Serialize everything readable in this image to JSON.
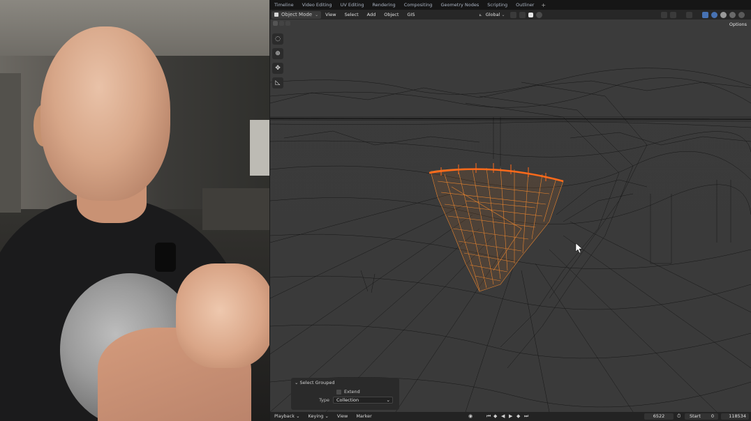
{
  "workspace_tabs": [
    "Timeline",
    "Video Editing",
    "UV Editing",
    "Rendering",
    "Compositing",
    "Geometry Nodes",
    "Scripting",
    "Outliner"
  ],
  "workspace_add": "+",
  "header": {
    "mode": "Object Mode",
    "menus": [
      "View",
      "Select",
      "Add",
      "Object",
      "GIS"
    ],
    "transform_orientation": "Global"
  },
  "viewport": {
    "options_label": "Options"
  },
  "redo_panel": {
    "title": "Select Grouped",
    "extend_label": "Extend",
    "type_label": "Type",
    "type_value": "Collection"
  },
  "timeline": {
    "menus": [
      "Playback",
      "Keying",
      "View",
      "Marker"
    ],
    "current_frame": "6522",
    "start_label": "Start",
    "start_value": "0",
    "end_value": "118534"
  },
  "colors": {
    "selection": "#e8842e",
    "selection_active": "#ff6a1a",
    "wire": "#111111",
    "viewport_bg": "#3a3a3a"
  }
}
